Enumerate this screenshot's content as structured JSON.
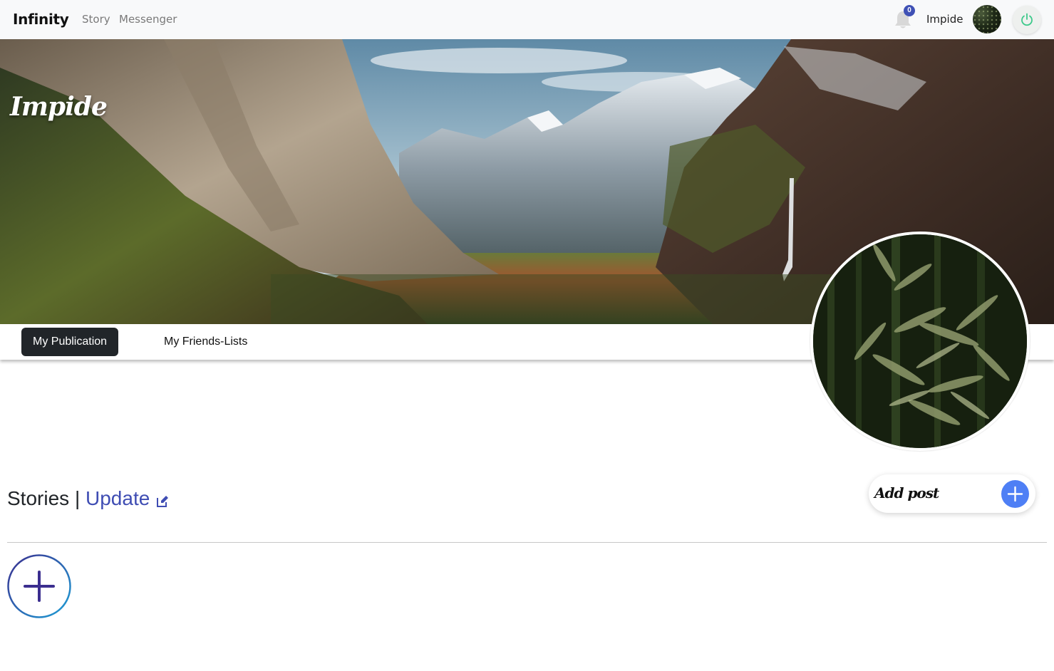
{
  "navbar": {
    "brand": "Infinity",
    "links": [
      "Story",
      "Messenger"
    ],
    "notification_count": "0",
    "username": "Impide",
    "icons": [
      "bell-icon",
      "avatar",
      "power-icon"
    ]
  },
  "cover": {
    "name": "Impide"
  },
  "tabs": [
    {
      "label": "My Publication",
      "active": true
    },
    {
      "label": "My Friends-Lists",
      "active": false
    }
  ],
  "stories": {
    "title": "Stories",
    "separator": "|",
    "update_label": "Update"
  },
  "add_post": {
    "label": "Add post"
  },
  "colors": {
    "accent": "#3f4db3",
    "badge": "#3f51b5",
    "add_button": "#4e7ff5",
    "active_tab": "#212529"
  }
}
